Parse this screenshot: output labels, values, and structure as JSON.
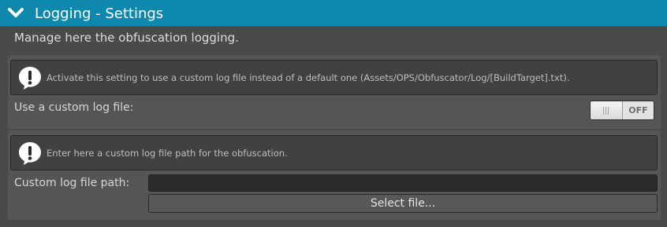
{
  "header": {
    "title": "Logging - Settings",
    "expand_icon": "chevron-down-icon",
    "color": "#0e89ad"
  },
  "description": "Manage here the obfuscation logging.",
  "custom_log": {
    "help_icon": "exclamation-speech-bubble-icon",
    "help_text": "Activate this setting to use a custom log file instead of a default one (Assets/OPS/Obfuscator/Log/[BuildTarget].txt).",
    "label": "Use a custom log file:",
    "toggle_state": "OFF",
    "toggle_on": false
  },
  "log_path": {
    "help_icon": "exclamation-speech-bubble-icon",
    "help_text": "Enter here a custom log file path for the obfuscation.",
    "label": "Custom log file path:",
    "value": "",
    "button_label": "Select file..."
  }
}
